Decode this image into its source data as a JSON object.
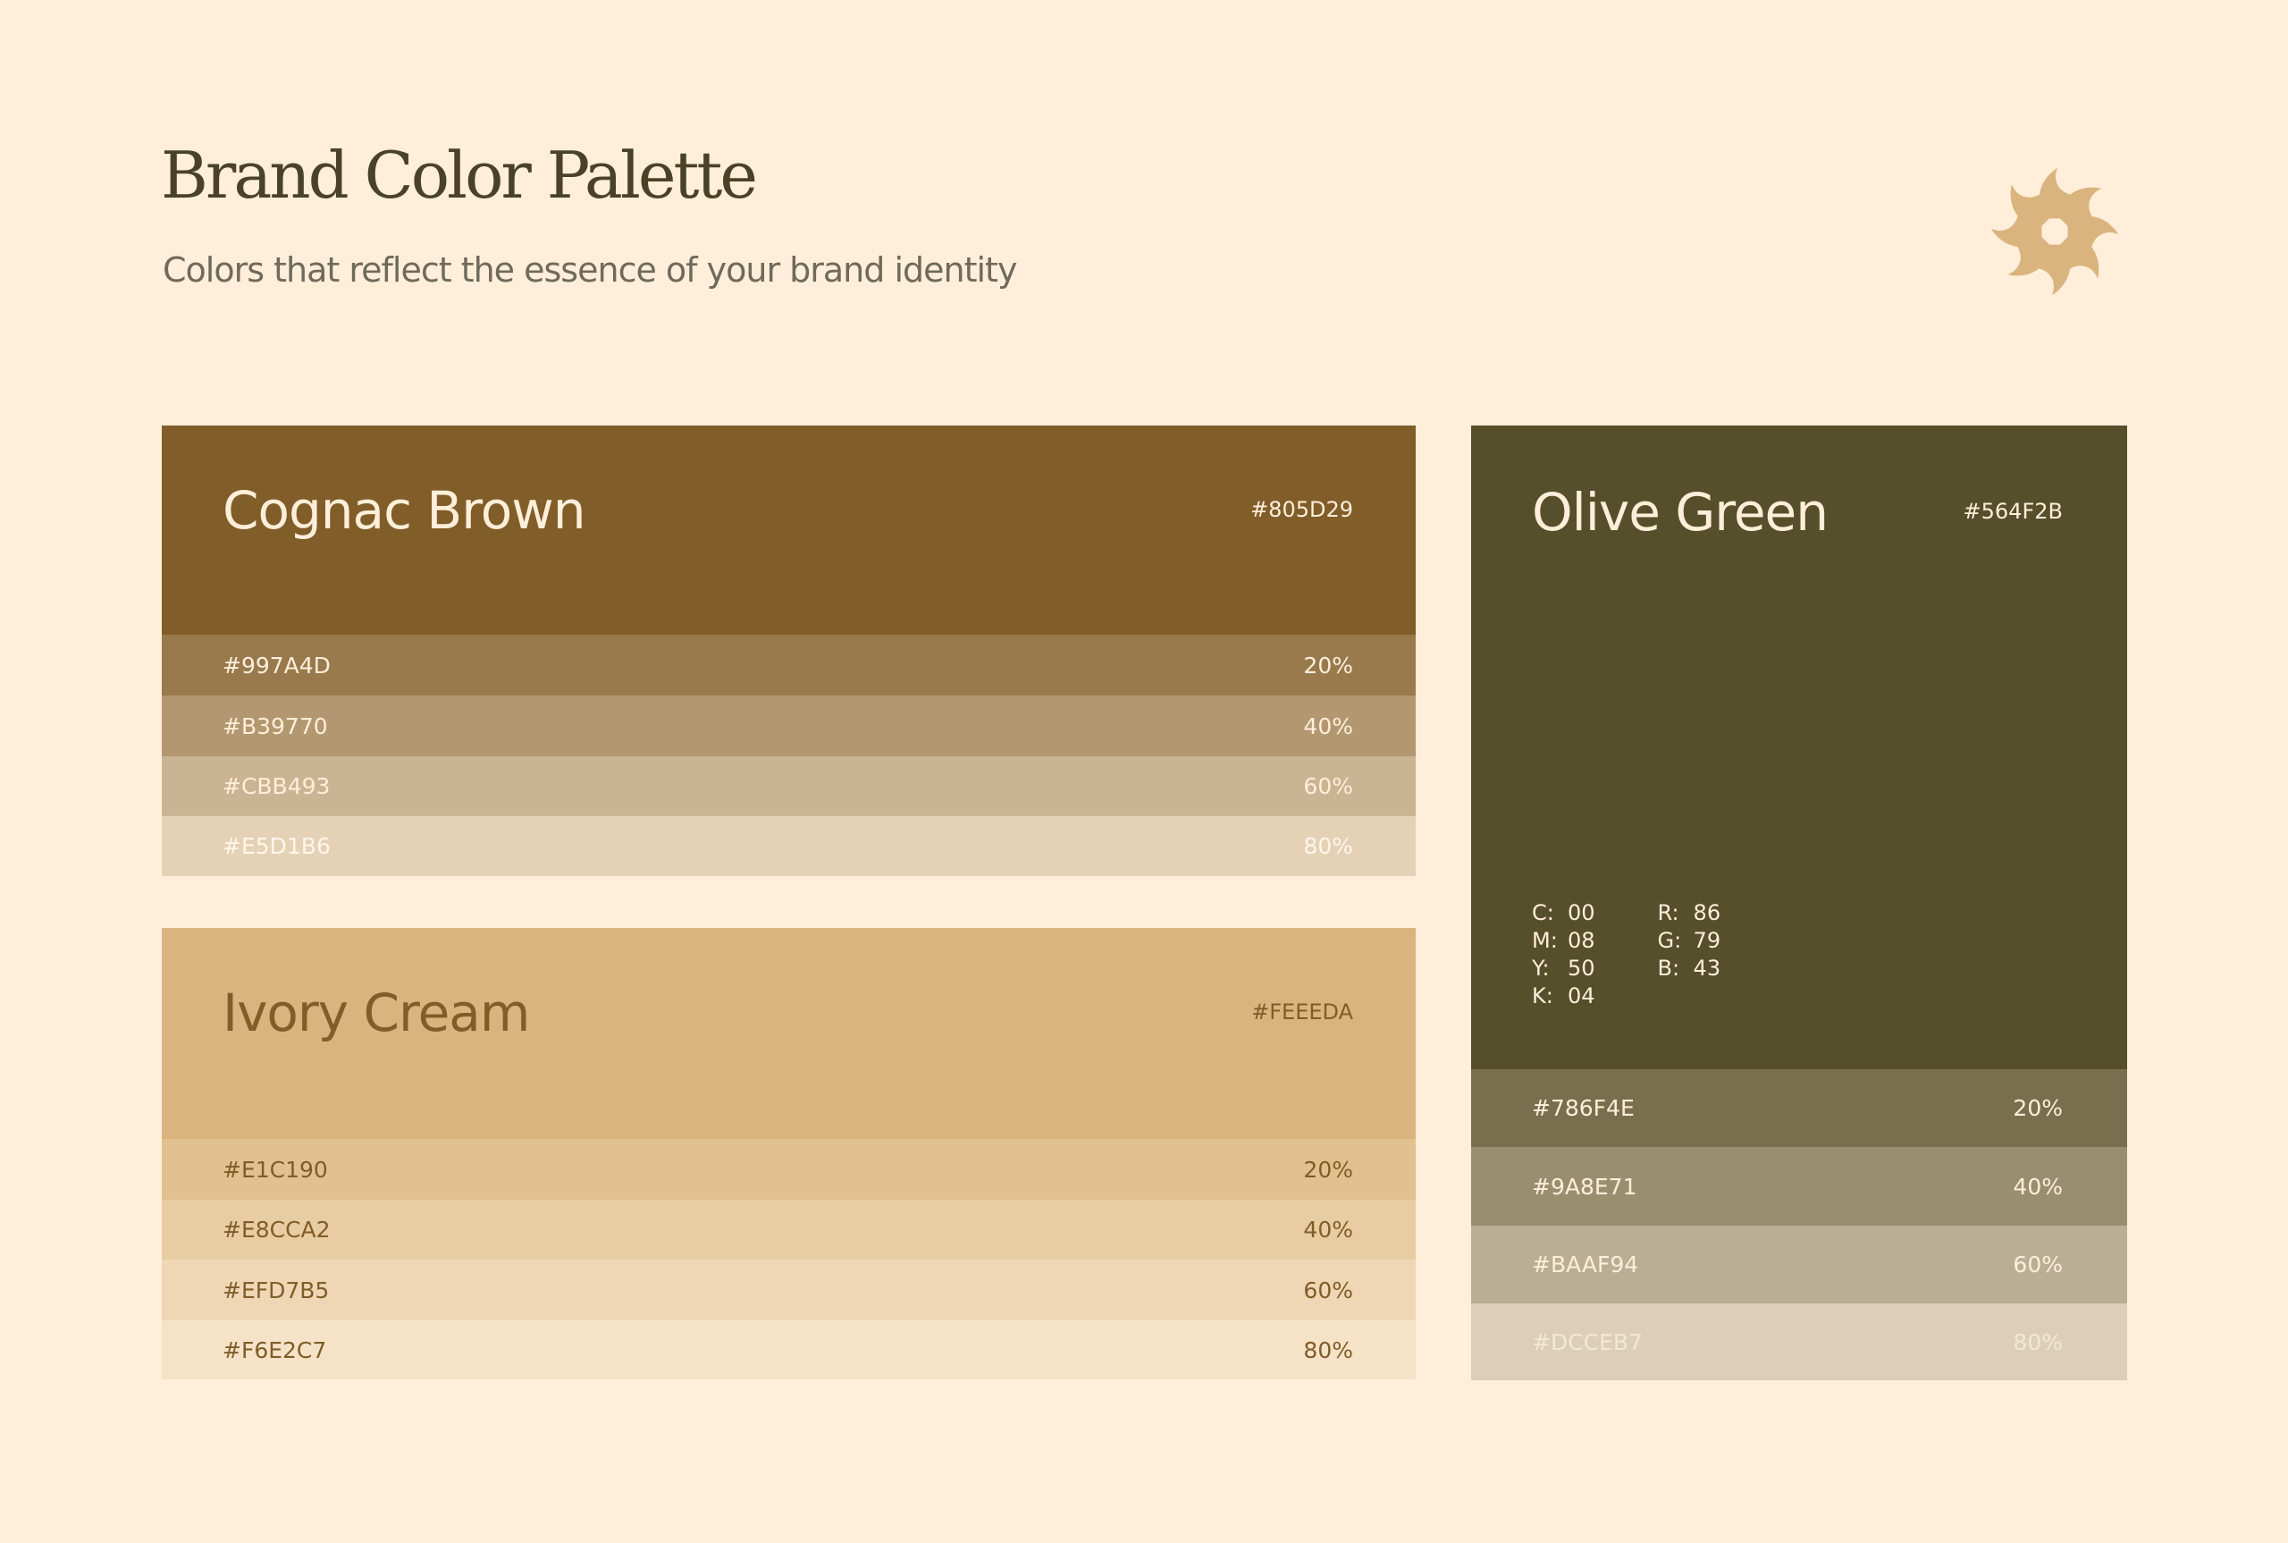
{
  "header": {
    "title": "Brand Color Palette",
    "subtitle": "Colors that reflect the essence of your brand identity"
  },
  "logo": {
    "icon": "pinwheel-logo-icon",
    "color": "#D9B47E"
  },
  "cards": {
    "cognac": {
      "name": "Cognac Brown",
      "hex": "#805D29",
      "color": "#805D29",
      "tints": [
        {
          "hex": "#997A4D",
          "pct": "20%"
        },
        {
          "hex": "#B39770",
          "pct": "40%"
        },
        {
          "hex": "#CBB493",
          "pct": "60%"
        },
        {
          "hex": "#E5D1B6",
          "pct": "80%"
        }
      ]
    },
    "ivory": {
      "name": "Ivory Cream",
      "hex": "#FEEEDA",
      "color": "#D9B47E",
      "tints": [
        {
          "hex": "#E1C190",
          "pct": "20%"
        },
        {
          "hex": "#E8CCA2",
          "pct": "40%"
        },
        {
          "hex": "#EFD7B5",
          "pct": "60%"
        },
        {
          "hex": "#F6E2C7",
          "pct": "80%"
        }
      ]
    },
    "olive": {
      "name": "Olive Green",
      "hex": "#564F2B",
      "color": "#564F2B",
      "cmyk": [
        {
          "k": "C:",
          "v": "00"
        },
        {
          "k": "M:",
          "v": "08"
        },
        {
          "k": "Y:",
          "v": "50"
        },
        {
          "k": "K:",
          "v": "04"
        }
      ],
      "rgb": [
        {
          "k": "R:",
          "v": "86"
        },
        {
          "k": "G:",
          "v": "79"
        },
        {
          "k": "B:",
          "v": "43"
        }
      ],
      "tints": [
        {
          "hex": "#786F4E",
          "pct": "20%"
        },
        {
          "hex": "#9A8E71",
          "pct": "40%"
        },
        {
          "hex": "#BAAF94",
          "pct": "60%"
        },
        {
          "hex": "#DCCEB7",
          "pct": "80%"
        }
      ]
    }
  }
}
